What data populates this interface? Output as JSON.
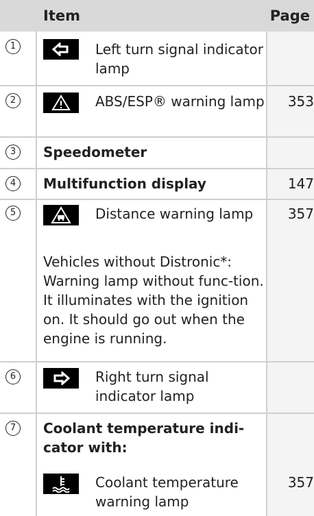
{
  "header": {
    "item_label": "Item",
    "page_label": "Page"
  },
  "rows": [
    {
      "number": "1",
      "icon": "left-arrow-icon",
      "text": "Left turn signal indicator lamp",
      "page": ""
    },
    {
      "number": "2",
      "icon": "warning-triangle-icon",
      "text": "ABS/ESP® warning lamp",
      "page": "353"
    },
    {
      "number": "3",
      "text": "Speedometer",
      "page": ""
    },
    {
      "number": "4",
      "text": "Multifunction display",
      "page": "147"
    },
    {
      "number": "5",
      "icon": "distance-warning-icon",
      "text": "Distance warning lamp",
      "page": "357"
    },
    {
      "note": "Vehicles without Distronic*: Warning lamp without func-tion. It illuminates with the ignition on. It should go out when the engine is running."
    },
    {
      "number": "6",
      "icon": "right-arrow-icon",
      "text": "Right turn signal indicator lamp",
      "page": ""
    },
    {
      "number": "7",
      "text": "Coolant temperature indi-cator with:",
      "page": ""
    },
    {
      "icon": "coolant-temperature-icon",
      "text": "Coolant temperature warning lamp",
      "page": "357"
    }
  ]
}
